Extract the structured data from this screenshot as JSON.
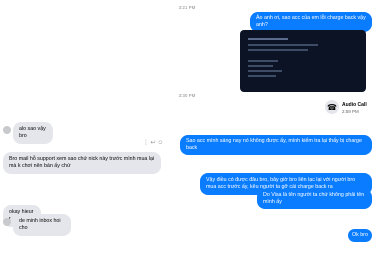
{
  "timestamps": {
    "first": "3:21 PM",
    "second": "3:30 PM"
  },
  "messages": [
    {
      "id": "m1",
      "side": "out",
      "text": "Ảo anh ơi, sao acc của em lỗi charge back vậy anh?"
    },
    {
      "id": "m3",
      "side": "in",
      "text": "alo sao vậy bro"
    },
    {
      "id": "m4",
      "side": "out",
      "text": "Sao acc mình sáng nay nó không được ấy, mình kiểm tra lại thấy bị charge back"
    },
    {
      "id": "m5",
      "side": "in",
      "text": "Bro mail hỗ support xem sao chứ nick này trước mình mua lại mà k chơi nên bán ấy chứ"
    },
    {
      "id": "m6",
      "side": "out",
      "text": "Vậy điều có được đâu bro, bây giờ bro liên lạc lại với người bro mua acc trước ấy, kêu người ta gỡ cái charge back ra"
    },
    {
      "id": "m7",
      "side": "out",
      "text": "Do Visa là tên người ta chứ không phải tên mình ấy"
    },
    {
      "id": "m8",
      "side": "in",
      "text": "okay hieur r"
    },
    {
      "id": "m9",
      "side": "in",
      "text": "de minh inbox hoi cho"
    },
    {
      "id": "m10",
      "side": "out",
      "text": "Ok bro"
    }
  ],
  "call": {
    "title": "Audio Call",
    "time": "2:59 PM"
  },
  "colors": {
    "outgoing": "#0a7cff",
    "incoming": "#e4e6eb"
  }
}
